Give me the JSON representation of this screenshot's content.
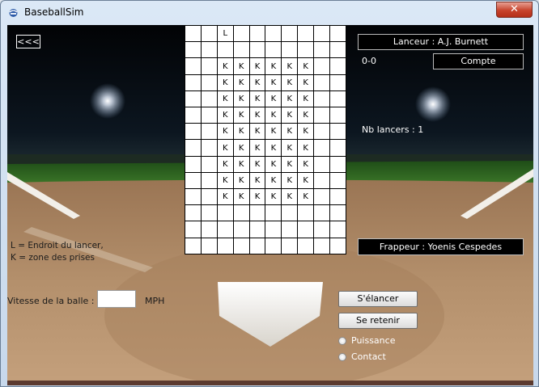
{
  "window": {
    "title": "BaseballSim",
    "close_glyph": "✕"
  },
  "nav": {
    "back_label": "<<<"
  },
  "grid": {
    "rows": [
      [
        "",
        "",
        "L",
        "",
        "",
        "",
        "",
        "",
        "",
        ""
      ],
      [
        "",
        "",
        "",
        "",
        "",
        "",
        "",
        "",
        "",
        ""
      ],
      [
        "",
        "",
        "K",
        "K",
        "K",
        "K",
        "K",
        "K",
        "",
        ""
      ],
      [
        "",
        "",
        "K",
        "K",
        "K",
        "K",
        "K",
        "K",
        "",
        ""
      ],
      [
        "",
        "",
        "K",
        "K",
        "K",
        "K",
        "K",
        "K",
        "",
        ""
      ],
      [
        "",
        "",
        "K",
        "K",
        "K",
        "K",
        "K",
        "K",
        "",
        ""
      ],
      [
        "",
        "",
        "K",
        "K",
        "K",
        "K",
        "K",
        "K",
        "",
        ""
      ],
      [
        "",
        "",
        "K",
        "K",
        "K",
        "K",
        "K",
        "K",
        "",
        ""
      ],
      [
        "",
        "",
        "K",
        "K",
        "K",
        "K",
        "K",
        "K",
        "",
        ""
      ],
      [
        "",
        "",
        "K",
        "K",
        "K",
        "K",
        "K",
        "K",
        "",
        ""
      ],
      [
        "",
        "",
        "K",
        "K",
        "K",
        "K",
        "K",
        "K",
        "",
        ""
      ],
      [
        "",
        "",
        "",
        "",
        "",
        "",
        "",
        "",
        "",
        ""
      ],
      [
        "",
        "",
        "",
        "",
        "",
        "",
        "",
        "",
        "",
        ""
      ],
      [
        "",
        "",
        "",
        "",
        "",
        "",
        "",
        "",
        "",
        ""
      ]
    ]
  },
  "pitcher": {
    "label": "Lanceur : A.J. Burnett"
  },
  "count": {
    "value": "0-0",
    "button_label": "Compte"
  },
  "pitches": {
    "label": "Nb lancers : 1"
  },
  "batter": {
    "label": "Frappeur : Yoenis Cespedes"
  },
  "legend": {
    "line1": "L = Endroit du lancer,",
    "line2": "K = zone des prises"
  },
  "speed": {
    "label": "Vitesse de la balle :",
    "value": "",
    "unit": "MPH"
  },
  "actions": {
    "swing_label": "S'élancer",
    "hold_label": "Se retenir"
  },
  "swing_type": {
    "options": [
      {
        "label": "Puissance",
        "selected": false
      },
      {
        "label": "Contact",
        "selected": false
      }
    ]
  },
  "colors": {
    "button_bg": "#000000",
    "button_text": "#ffffff",
    "grid_bg": "#ffffff",
    "close": "#c7432c"
  }
}
